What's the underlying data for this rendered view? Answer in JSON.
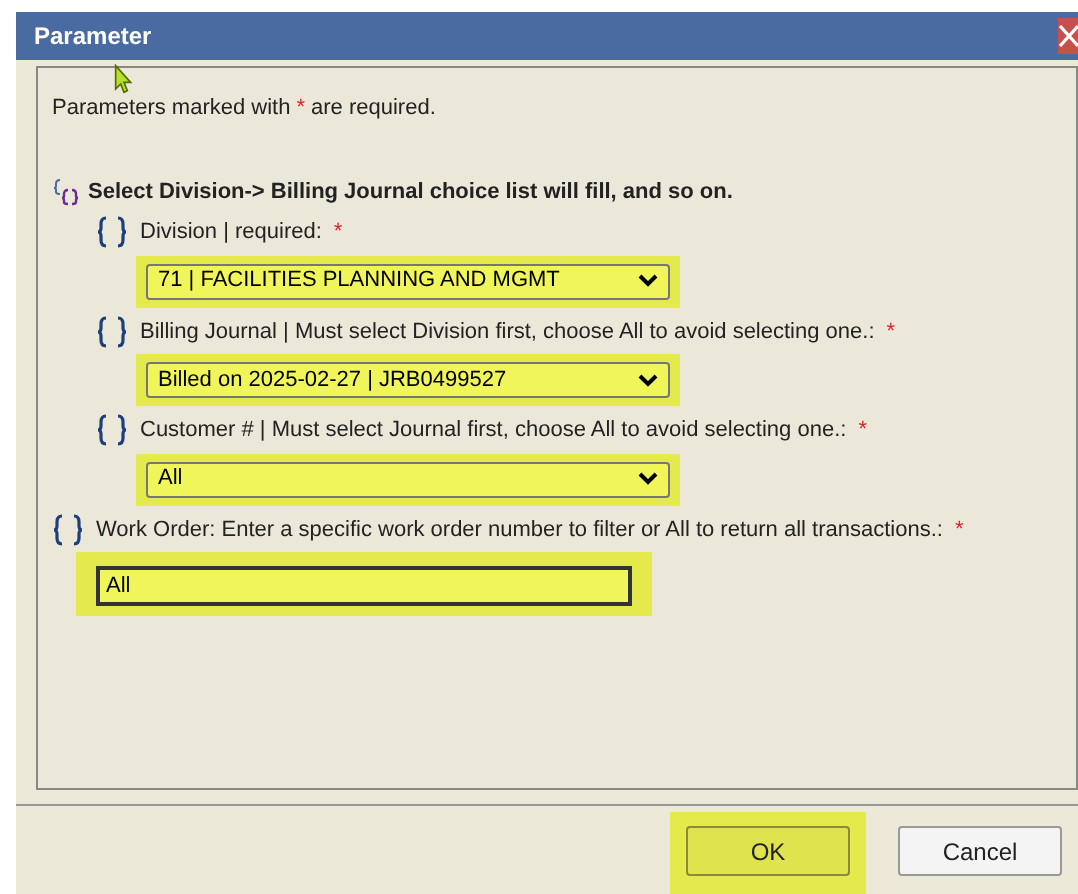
{
  "dialog": {
    "title": "Parameter"
  },
  "notice": {
    "text": "Parameters marked with",
    "mark": "*",
    "suffix": "are required."
  },
  "parameters": [
    {
      "kind": "group",
      "label": "Select Division-> Billing Journal choice list will fill, and so on.",
      "children": [
        {
          "kind": "select",
          "label": "Division | required:",
          "required": "*",
          "value": "71 | FACILITIES PLANNING AND MGMT",
          "highlighted": true
        },
        {
          "kind": "select",
          "label": "Billing Journal | Must select Division first, choose All to avoid selecting one.:",
          "required": "*",
          "value": "Billed on 2025-02-27 | JRB0499527",
          "highlighted": true
        },
        {
          "kind": "select",
          "label": "Customer # | Must select Journal first, choose All to avoid selecting one.:",
          "required": "*",
          "value": "All",
          "highlighted": true
        }
      ]
    },
    {
      "kind": "text",
      "label": "Work Order: Enter a specific work order number to filter or All to return all transactions.:",
      "required": "*",
      "value": "All",
      "highlighted": true
    }
  ],
  "buttons": [
    {
      "label": "OK",
      "highlighted": true
    },
    {
      "label": "Cancel",
      "highlighted": false
    }
  ]
}
